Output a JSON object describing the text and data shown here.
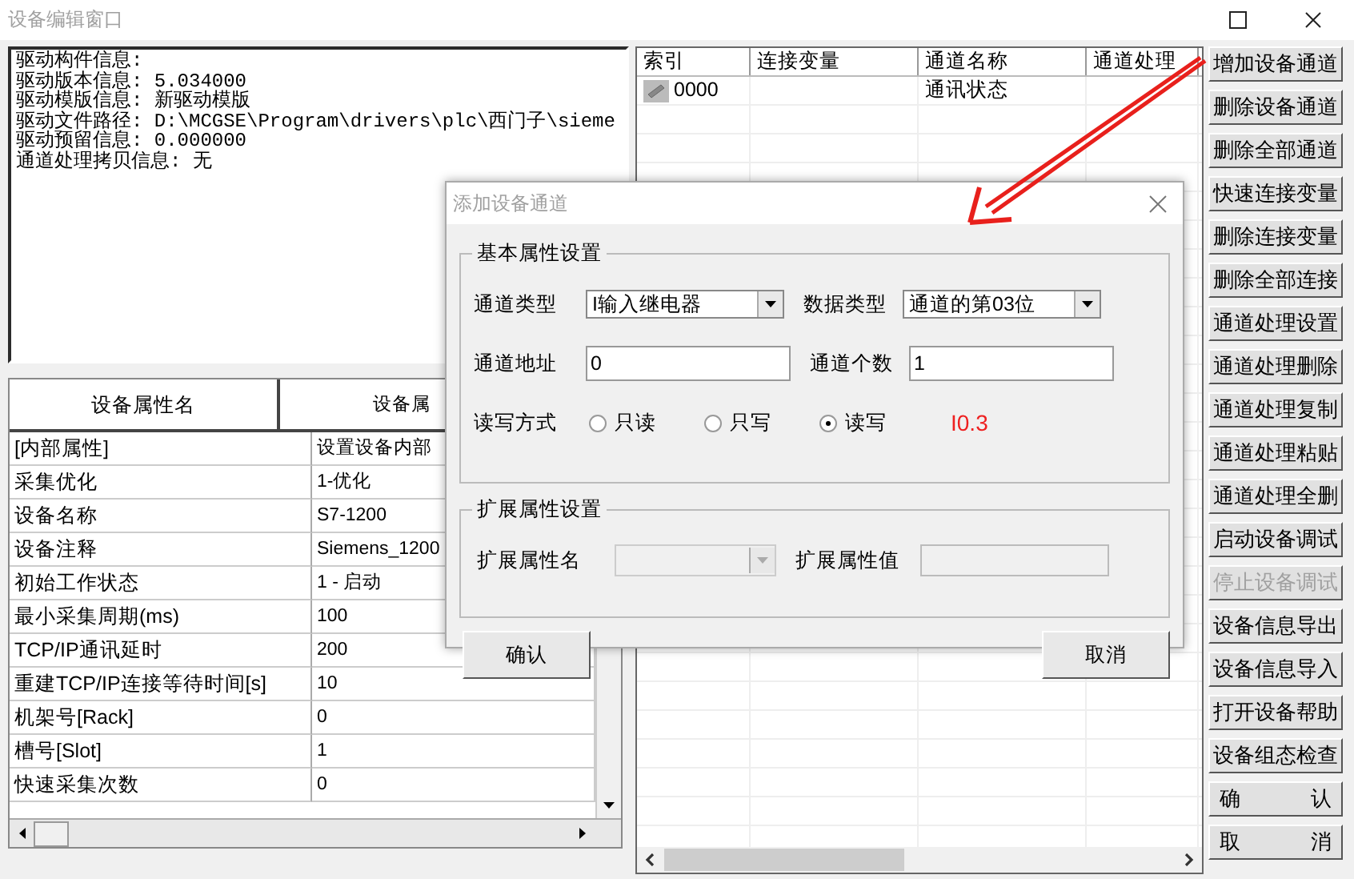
{
  "window": {
    "title": "设备编辑窗口"
  },
  "info_lines": [
    "驱动构件信息:",
    "驱动版本信息: 5.034000",
    "驱动模版信息: 新驱动模版",
    "驱动文件路径: D:\\MCGSE\\Program\\drivers\\plc\\西门子\\sieme",
    "驱动预留信息: 0.000000",
    "通道处理拷贝信息: 无"
  ],
  "property_table": {
    "columns": [
      "设备属性名",
      "设备属"
    ],
    "rows": [
      {
        "name": "[内部属性]",
        "value": "设置设备内部"
      },
      {
        "name": "采集优化",
        "value": "1-优化"
      },
      {
        "name": "设备名称",
        "value": "S7-1200"
      },
      {
        "name": "设备注释",
        "value": "Siemens_1200"
      },
      {
        "name": "初始工作状态",
        "value": "1 - 启动"
      },
      {
        "name": "最小采集周期(ms)",
        "value": "100"
      },
      {
        "name": "TCP/IP通讯延时",
        "value": "200"
      },
      {
        "name": "重建TCP/IP连接等待时间[s]",
        "value": "10"
      },
      {
        "name": "机架号[Rack]",
        "value": "0"
      },
      {
        "name": "槽号[Slot]",
        "value": "1"
      },
      {
        "name": "快速采集次数",
        "value": "0"
      }
    ]
  },
  "channel_table": {
    "columns": [
      "索引",
      "连接变量",
      "通道名称",
      "通道处理"
    ],
    "rows": [
      {
        "index": "0000",
        "variable": "",
        "name": "通讯状态",
        "processing": ""
      }
    ]
  },
  "side_buttons": [
    {
      "label": "增加设备通道",
      "disabled": false
    },
    {
      "label": "删除设备通道",
      "disabled": false
    },
    {
      "label": "删除全部通道",
      "disabled": false
    },
    {
      "label": "快速连接变量",
      "disabled": false
    },
    {
      "label": "删除连接变量",
      "disabled": false
    },
    {
      "label": "删除全部连接",
      "disabled": false
    },
    {
      "label": "通道处理设置",
      "disabled": false
    },
    {
      "label": "通道处理删除",
      "disabled": false
    },
    {
      "label": "通道处理复制",
      "disabled": false
    },
    {
      "label": "通道处理粘贴",
      "disabled": false
    },
    {
      "label": "通道处理全删",
      "disabled": false
    },
    {
      "label": "启动设备调试",
      "disabled": false
    },
    {
      "label": "停止设备调试",
      "disabled": true
    },
    {
      "label": "设备信息导出",
      "disabled": false
    },
    {
      "label": "设备信息导入",
      "disabled": false
    },
    {
      "label": "打开设备帮助",
      "disabled": false
    },
    {
      "label": "设备组态检查",
      "disabled": false
    },
    {
      "label": "确 认",
      "disabled": false
    },
    {
      "label": "取 消",
      "disabled": false
    }
  ],
  "dialog": {
    "title": "添加设备通道",
    "basic_group": {
      "title": "基本属性设置",
      "channel_type": {
        "label": "通道类型",
        "value": "I输入继电器"
      },
      "data_type": {
        "label": "数据类型",
        "value": "通道的第03位"
      },
      "channel_address": {
        "label": "通道地址",
        "value": "0"
      },
      "channel_count": {
        "label": "通道个数",
        "value": "1"
      },
      "rw_mode": {
        "label": "读写方式",
        "options": [
          {
            "label": "只读",
            "selected": false
          },
          {
            "label": "只写",
            "selected": false
          },
          {
            "label": "读写",
            "selected": true
          }
        ]
      },
      "address_preview": "I0.3"
    },
    "ext_group": {
      "title": "扩展属性设置",
      "ext_name": {
        "label": "扩展属性名",
        "disabled": true
      },
      "ext_value": {
        "label": "扩展属性值",
        "disabled": true
      }
    },
    "buttons": [
      "确认",
      "取消"
    ]
  }
}
